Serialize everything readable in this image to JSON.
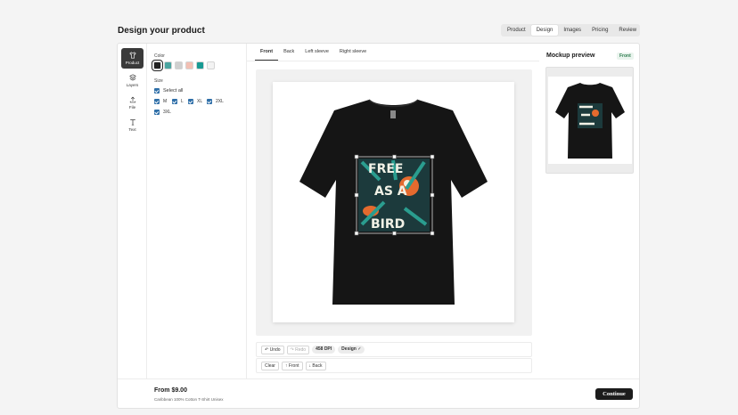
{
  "page": {
    "title": "Design your product"
  },
  "steps": [
    {
      "label": "Product"
    },
    {
      "label": "Design"
    },
    {
      "label": "Images"
    },
    {
      "label": "Pricing"
    },
    {
      "label": "Review"
    }
  ],
  "tools": [
    {
      "label": "Product",
      "icon": "tshirt-icon"
    },
    {
      "label": "Layers",
      "icon": "layers-icon"
    },
    {
      "label": "File",
      "icon": "upload-icon"
    },
    {
      "label": "Text",
      "icon": "text-icon"
    }
  ],
  "options": {
    "color_label": "Color",
    "colors": [
      "#222222",
      "#4aa5a0",
      "#cfcfcf",
      "#f2bfb3",
      "#179a93",
      "#f3f3f3"
    ],
    "size_label": "Size",
    "select_all_label": "Select all",
    "sizes": [
      "M",
      "L",
      "XL",
      "2XL",
      "3XL"
    ]
  },
  "view_tabs": [
    {
      "label": "Front"
    },
    {
      "label": "Back"
    },
    {
      "label": "Left sleeve"
    },
    {
      "label": "Right sleeve"
    }
  ],
  "artwork": {
    "lines": [
      "FREE",
      "AS A",
      "BIRD"
    ]
  },
  "toolbar": {
    "undo": "↶ Undo",
    "redo": "↷ Redo",
    "dpi": "458 DPI",
    "design_badge": "Design ✓",
    "clear": "Clear",
    "front": "↑ Front",
    "back": "↓ Back"
  },
  "preview": {
    "title": "Mockup preview",
    "badge": "Front"
  },
  "footer": {
    "price": "From $9.00",
    "product_name": "Caribbean 100% Cotton T-Shirt Unisex",
    "continue_label": "Continue"
  },
  "colors": {
    "shirt": "#151515",
    "accent_green": "#2e7d4f",
    "checkbox": "#2f6fa8"
  }
}
